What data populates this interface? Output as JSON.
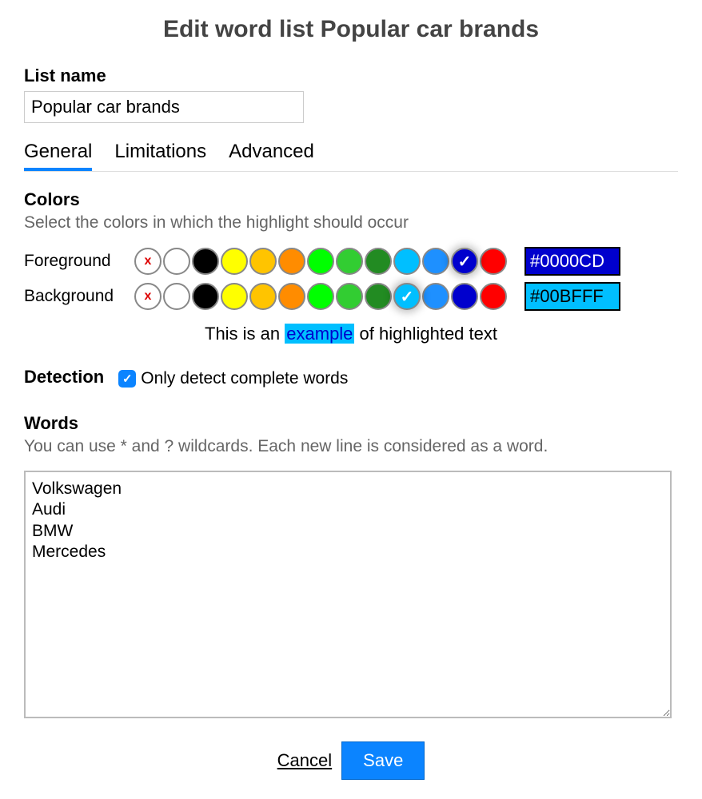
{
  "title": "Edit word list Popular car brands",
  "list_name": {
    "label": "List name",
    "value": "Popular car brands"
  },
  "tabs": [
    {
      "label": "General",
      "active": true
    },
    {
      "label": "Limitations",
      "active": false
    },
    {
      "label": "Advanced",
      "active": false
    }
  ],
  "colors": {
    "title": "Colors",
    "desc": "Select the colors in which the highlight should occur",
    "foreground_label": "Foreground",
    "background_label": "Background",
    "foreground_selected": "#0000CD",
    "background_selected": "#00BFFF",
    "palette": [
      "none",
      "#FFFFFF",
      "#000000",
      "#FFFF00",
      "#FFC400",
      "#FF8C00",
      "#00FF00",
      "#32CD32",
      "#228B22",
      "#00BFFF",
      "#1E90FF",
      "#0000CD",
      "#FF0000"
    ],
    "foreground_hex": "#0000CD",
    "background_hex": "#00BFFF"
  },
  "example": {
    "prefix": "This is an ",
    "word": "example",
    "suffix": " of highlighted text"
  },
  "detection": {
    "title": "Detection",
    "checkbox_label": "Only detect complete words",
    "checked": true
  },
  "words": {
    "title": "Words",
    "desc": "You can use * and ? wildcards. Each new line is considered as a word.",
    "value": "Volkswagen\nAudi\nBMW\nMercedes"
  },
  "buttons": {
    "cancel": "Cancel",
    "save": "Save"
  }
}
